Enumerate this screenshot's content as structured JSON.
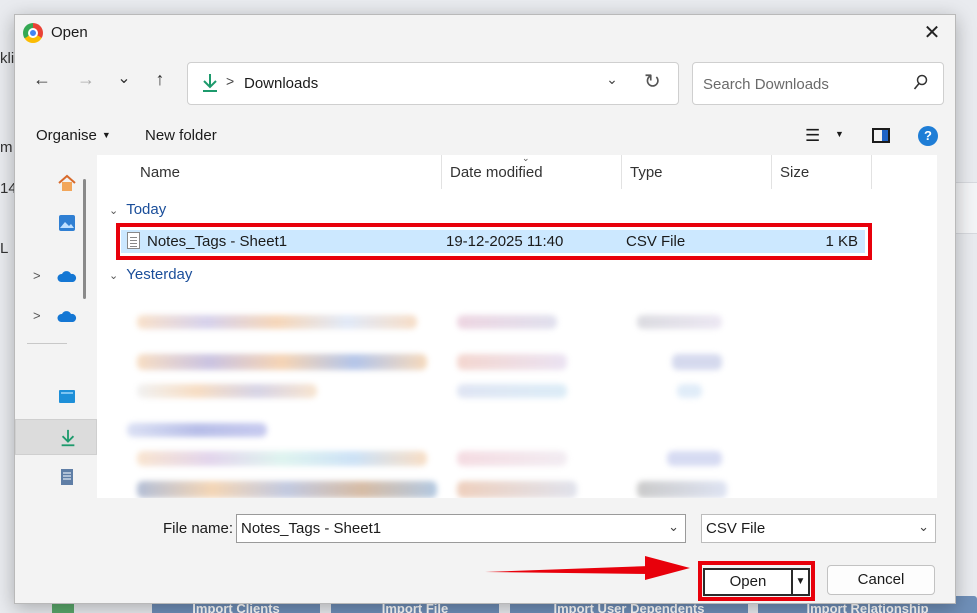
{
  "dialog": {
    "title": "Open",
    "close_label": "✕"
  },
  "nav": {
    "back": "←",
    "forward": "→",
    "recent": "⌄",
    "up": "↑"
  },
  "address": {
    "separator": ">",
    "location": "Downloads",
    "dropdown": "⌄",
    "refresh": "↻"
  },
  "search": {
    "placeholder": "Search Downloads"
  },
  "toolbar": {
    "organise": "Organise",
    "new_folder": "New folder",
    "view_icon": "☰",
    "help": "?"
  },
  "columns": {
    "name": "Name",
    "date": "Date modified",
    "type": "Type",
    "size": "Size"
  },
  "groups": {
    "today": "Today",
    "yesterday": "Yesterday"
  },
  "files": [
    {
      "name": "Notes_Tags - Sheet1",
      "date": "19-12-2025 11:40",
      "type": "CSV File",
      "size": "1 KB",
      "selected": true
    }
  ],
  "bottom": {
    "file_name_label": "File name:",
    "file_name_value": "Notes_Tags - Sheet1",
    "file_type_value": "CSV File",
    "open_label": "Open",
    "cancel_label": "Cancel"
  },
  "background": {
    "left_fragments": [
      "kli",
      "m",
      "14",
      "L"
    ],
    "bottom_buttons": [
      "Import Clients",
      "Import File",
      "Import User Dependents",
      "Import Relationship"
    ]
  },
  "colors": {
    "highlight": "#e8000b",
    "selection": "#cce8ff",
    "group_text": "#1a4e9a",
    "accent": "#1e7dd6"
  },
  "icons": {
    "app": "chrome-icon",
    "downloads": "download-arrow-icon",
    "home": "home-icon",
    "gallery": "gallery-icon",
    "onedrive": "cloud-icon",
    "desktop": "desktop-icon",
    "documents": "document-icon",
    "search": "search-icon",
    "help": "help-icon"
  }
}
